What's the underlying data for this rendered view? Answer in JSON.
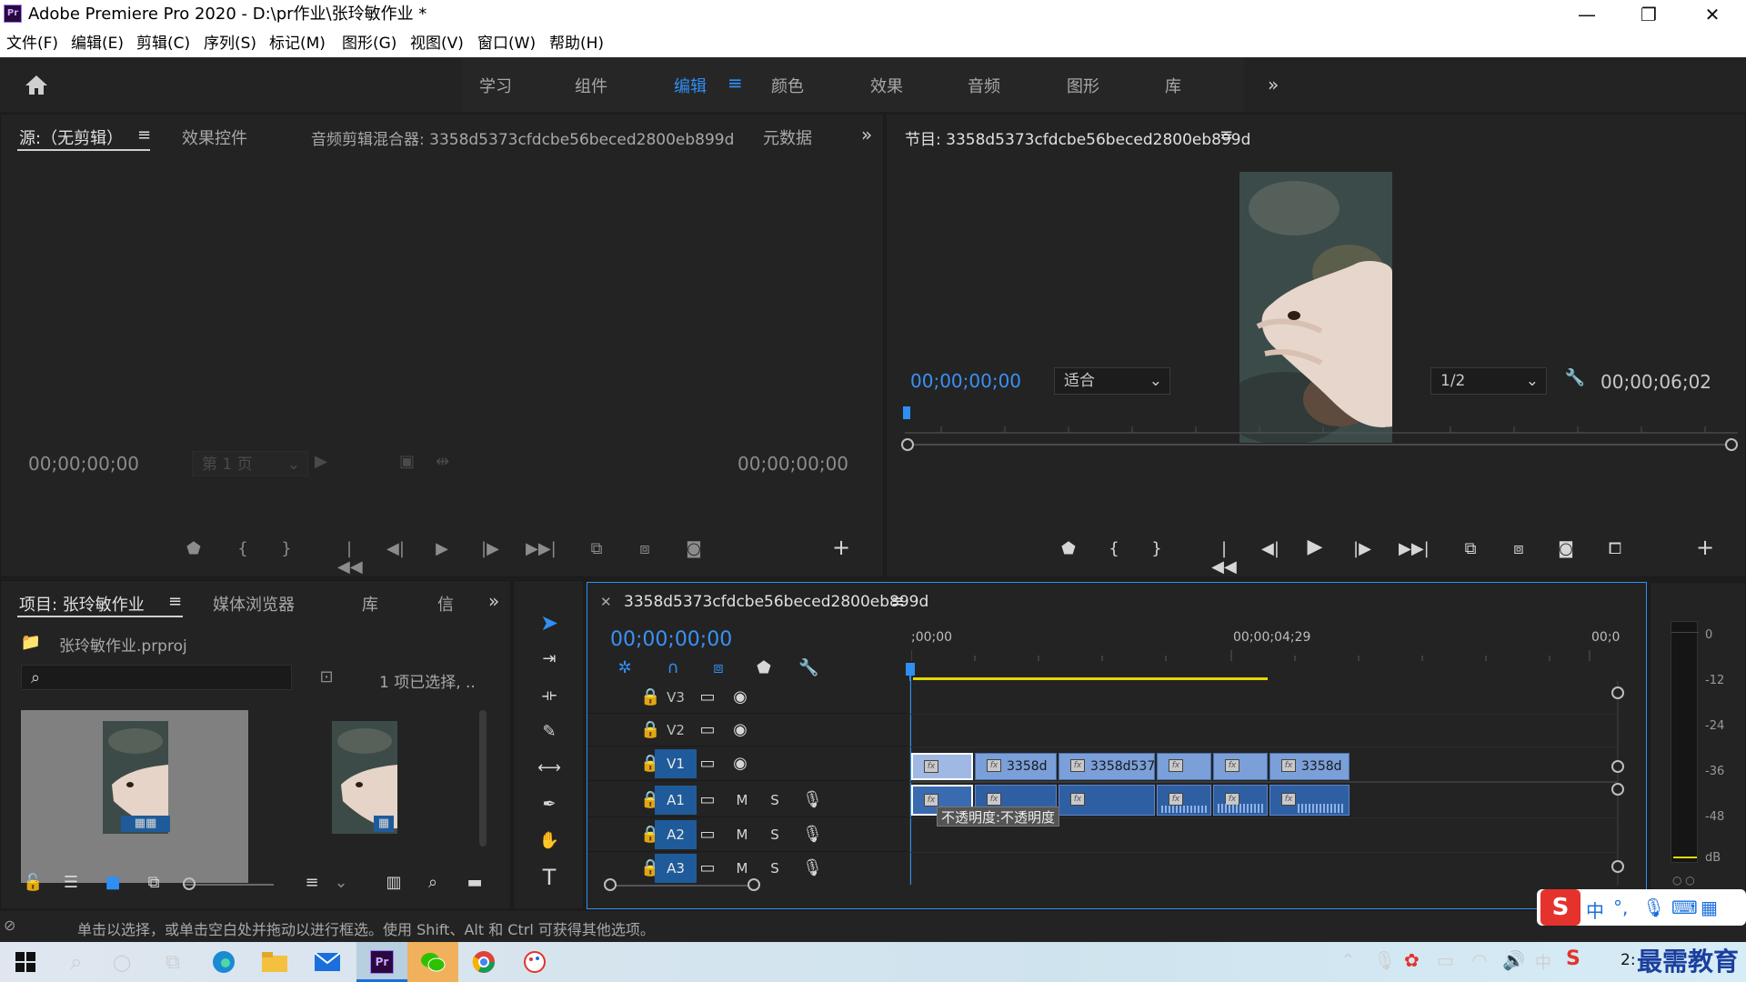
{
  "window": {
    "title": "Adobe Premiere Pro 2020 - D:\\pr作业\\张玲敏作业 *",
    "app_logo": "Pr"
  },
  "menu": [
    "文件(F)",
    "编辑(E)",
    "剪辑(C)",
    "序列(S)",
    "标记(M)",
    "图形(G)",
    "视图(V)",
    "窗口(W)",
    "帮助(H)"
  ],
  "workspaces": {
    "tabs": [
      "学习",
      "组件",
      "编辑",
      "颜色",
      "效果",
      "音频",
      "图形",
      "库"
    ],
    "active": "编辑"
  },
  "source_panel": {
    "tabs": [
      "源:（无剪辑）",
      "效果控件",
      "音频剪辑混合器: 3358d5373cfdcbe56beced2800eb899d",
      "元数据"
    ],
    "timecode_left": "00;00;00;00",
    "timecode_right": "00;00;00;00",
    "page_select": "第 1 页"
  },
  "program_panel": {
    "title": "节目: 3358d5373cfdcbe56beced2800eb899d",
    "timecode": "00;00;00;00",
    "fit": "适合",
    "resolution": "1/2",
    "duration": "00;00;06;02"
  },
  "project_panel": {
    "tabs": [
      "项目: 张玲敏作业",
      "媒体浏览器",
      "库",
      "信"
    ],
    "file": "张玲敏作业.prproj",
    "selection": "1 项已选择, ..",
    "search_placeholder": ""
  },
  "timeline": {
    "sequence_name": "3358d5373cfdcbe56beced2800eb899d",
    "timecode": "00;00;00;00",
    "ruler": [
      ";00;00",
      "00;00;04;29",
      "00;0"
    ],
    "video_tracks": [
      "V3",
      "V2",
      "V1"
    ],
    "audio_tracks": [
      "A1",
      "A2",
      "A3"
    ],
    "mute": "M",
    "solo": "S",
    "clips": [
      "3358d",
      "3358d537",
      "3358d"
    ],
    "tooltip": "不透明度:不透明度"
  },
  "meter": {
    "scale": [
      "0",
      "-12",
      "-24",
      "-36",
      "-48",
      "dB"
    ]
  },
  "status": "单击以选择，或单击空白处并拖动以进行框选。使用 Shift、Alt 和 Ctrl 可获得其他选项。",
  "ime": {
    "lang": "中",
    "punct": "°,"
  },
  "tray": {
    "clock": "2:",
    "watermark": "最需教育",
    "lang": "中"
  },
  "colors": {
    "accent": "#2f8ff5",
    "clip_video": "#7b9fd8",
    "clip_audio": "#2f5fa3",
    "work_area": "#e4d800"
  }
}
